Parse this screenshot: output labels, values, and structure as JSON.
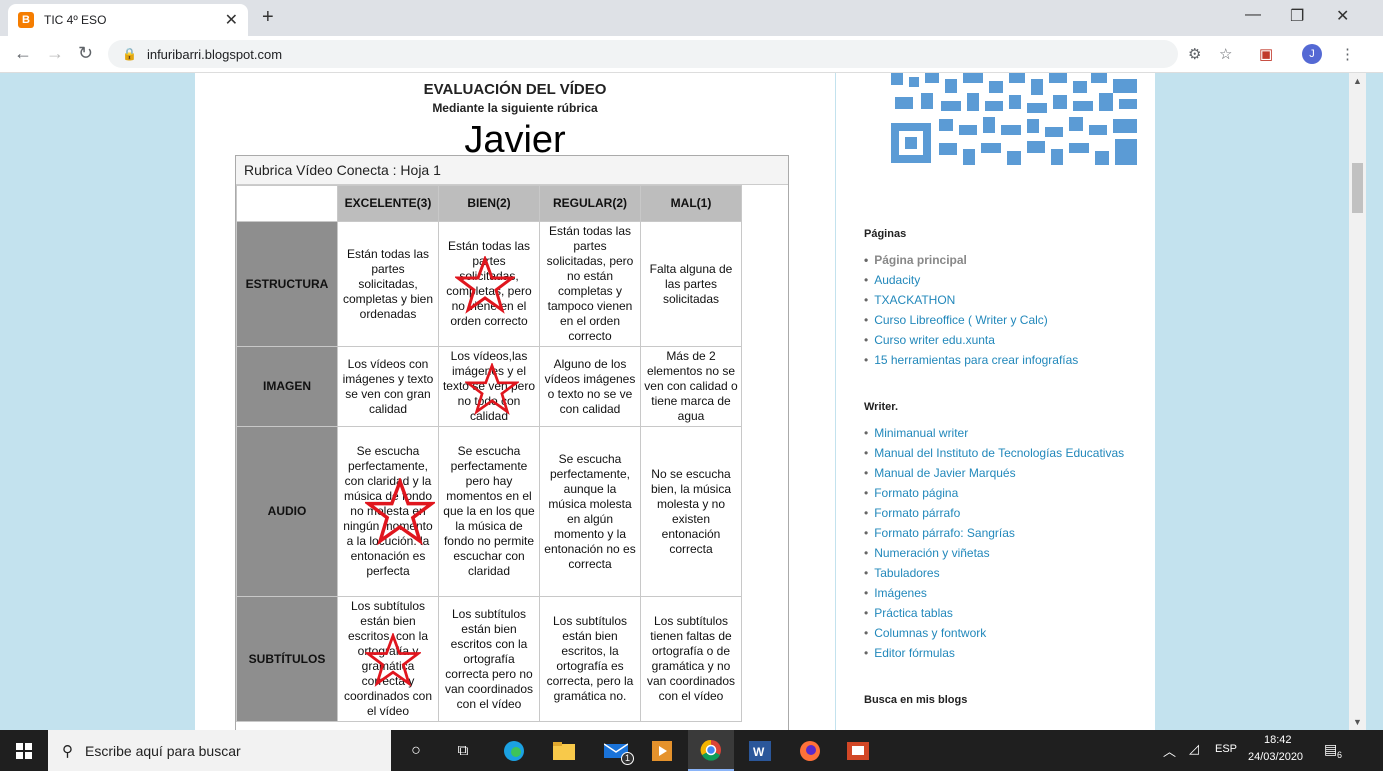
{
  "browser": {
    "tab_title": "TIC 4º ESO",
    "url": "infuribarri.blogspot.com",
    "avatar_letter": "J"
  },
  "post": {
    "title": "EVALUACIÓN DEL VÍDEO",
    "subtitle": "Mediante la siguiente rúbrica",
    "name": "Javier"
  },
  "sheet": {
    "title": "Rubrica Vídeo Conecta : Hoja 1",
    "headers": [
      "EXCELENTE(3)",
      "BIEN(2)",
      "REGULAR(2)",
      "MAL(1)"
    ],
    "rows": [
      {
        "label": "ESTRUCTURA",
        "cells": [
          "Están todas las partes solicitadas, completas y bien ordenadas",
          "Están todas las partes solicitadas, completas, pero no viene en el orden correcto",
          "Están todas las partes solicitadas, pero no están completas y tampoco vienen en el orden correcto",
          "Falta alguna de las partes solicitadas"
        ]
      },
      {
        "label": "IMAGEN",
        "cells": [
          "Los vídeos con imágenes y texto se ven con gran calidad",
          "Los vídeos,las imágenes y el texto se ven pero no todo con calidad",
          "Alguno de los vídeos imágenes o texto no se ve con calidad",
          "Más de 2 elementos no se ven con calidad o tiene marca de agua"
        ]
      },
      {
        "label": "AUDIO",
        "cells": [
          "Se escucha perfectamente, con claridad y la música de fondo no molesta en ningún momento a la locución. la entonación es perfecta",
          "Se escucha perfectamente pero hay momentos en el que la en los que la música de fondo no permite escuchar con claridad",
          "Se escucha perfectamente, aunque la música molesta en algún momento y la entonación no es correcta",
          "No se escucha bien, la música molesta y no existen entonación correcta"
        ]
      },
      {
        "label": "SUBTÍTULOS",
        "cells": [
          "Los subtítulos están bien escritos, con la ortografía y gramática correcta y coordinados con el vídeo",
          "Los subtítulos están bien escritos con la ortografía correcta pero no van coordinados con el vídeo",
          "Los subtítulos están bien escritos, la ortografía es correcta, pero la gramática no.",
          "Los subtítulos tienen faltas de ortografía o de gramática y no van coordinados con el vídeo"
        ]
      }
    ]
  },
  "sidebar": {
    "pages_title": "Páginas",
    "pages": [
      "Página principal",
      "Audacity",
      "TXACKATHON",
      "Curso Libreoffice ( Writer y Calc)",
      "Curso writer edu.xunta",
      "15 herramientas para crear infografías"
    ],
    "writer_title": "Writer.",
    "writer": [
      "Minimanual writer",
      "Manual del Instituto de Tecnologías Educativas",
      "Manual de Javier Marqués",
      "Formato página",
      "Formato párrafo",
      "Formato párrafo: Sangrías",
      "Numeración y viñetas",
      "Tabuladores",
      "Imágenes",
      "Práctica tablas",
      "Columnas y fontwork",
      "Editor fórmulas"
    ],
    "search_title": "Busca en mis blogs"
  },
  "taskbar": {
    "search_placeholder": "Escribe aquí para buscar",
    "lang": "ESP",
    "time": "18:42",
    "date": "24/03/2020",
    "notif_count": "6",
    "mail_badge": "1"
  },
  "colors": {
    "qr": "#5b9bd5",
    "star": "#e0161e",
    "link": "#2288bb"
  }
}
